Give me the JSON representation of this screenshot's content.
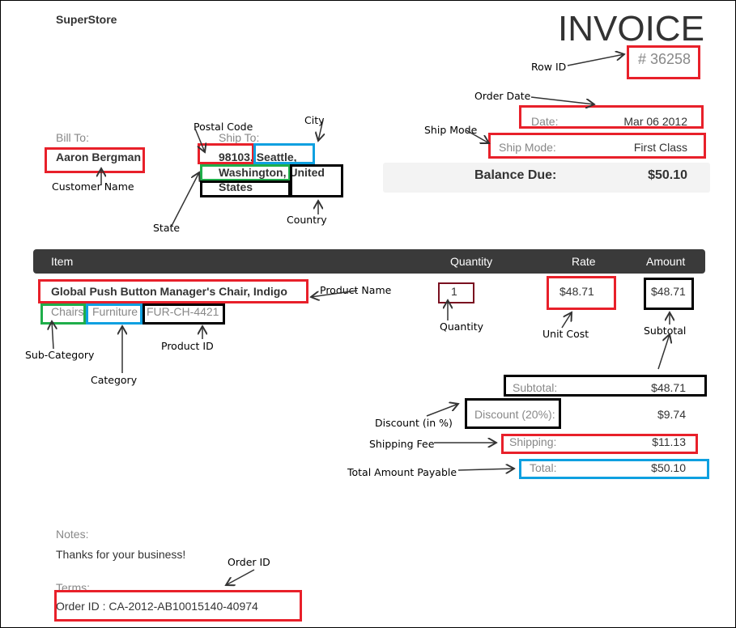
{
  "company": "SuperStore",
  "title": "INVOICE",
  "row_id": "# 36258",
  "order_date": {
    "label": "Date:",
    "value": "Mar 06 2012"
  },
  "ship_mode": {
    "label": "Ship Mode:",
    "value": "First Class"
  },
  "balance_due": {
    "label": "Balance Due:",
    "value": "$50.10"
  },
  "bill_to": {
    "label": "Bill To:",
    "name": "Aaron Bergman"
  },
  "ship_to": {
    "label": "Ship To:",
    "line1": "98103, Seattle,",
    "line2": "Washington, United",
    "line3": "States"
  },
  "table": {
    "headers": [
      "Item",
      "Quantity",
      "Rate",
      "Amount"
    ],
    "row": {
      "product_name": "Global Push Button Manager's Chair, Indigo",
      "sub_category": "Chairs",
      "category": "Furniture",
      "product_id": "FUR-CH-4421",
      "quantity": "1",
      "rate": "$48.71",
      "amount": "$48.71"
    }
  },
  "totals": [
    {
      "label": "Subtotal:",
      "value": "$48.71"
    },
    {
      "label": "Discount (20%):",
      "value": "$9.74"
    },
    {
      "label": "Shipping:",
      "value": "$11.13"
    },
    {
      "label": "Total:",
      "value": "$50.10"
    }
  ],
  "notes": {
    "label": "Notes:",
    "text": "Thanks for your business!"
  },
  "terms": {
    "label": "Terms:",
    "text": "Order ID : CA-2012-AB10015140-40974"
  },
  "annotations": {
    "row_id": "Row ID",
    "order_date": "Order Date",
    "ship_mode": "Ship Mode",
    "postal_code": "Postal Code",
    "city": "City",
    "customer_name": "Customer Name",
    "state": "State",
    "country": "Country",
    "product_name": "Product Name",
    "quantity": "Quantity",
    "unit_cost": "Unit Cost",
    "subtotal": "Subtotal",
    "sub_category": "Sub-Category",
    "category": "Category",
    "product_id": "Product ID",
    "discount": "Discount (in %)",
    "shipping_fee": "Shipping Fee",
    "total": "Total Amount Payable",
    "order_id": "Order ID"
  },
  "colors": {
    "red": "#e8202a",
    "blue": "#0ea0e0",
    "green": "#1fae4a",
    "header": "#3a3a3a"
  }
}
